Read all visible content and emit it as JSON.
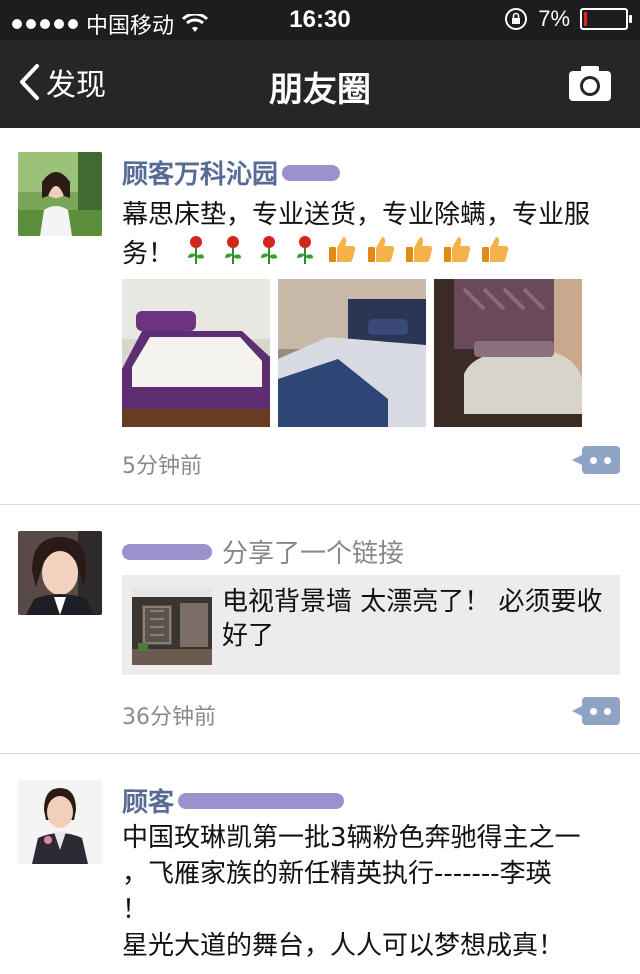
{
  "status_bar": {
    "carrier": "中国移动",
    "time": "16:30",
    "battery": "7%",
    "battery_level": 0.07,
    "colors": {
      "battery_low": "#e1251b"
    }
  },
  "nav": {
    "back_label": "发现",
    "title": "朋友圈"
  },
  "posts": [
    {
      "name": "顾客万科沁园",
      "text": "幕思床垫，专业送货，专业除螨，专业服务！",
      "emojis": [
        "rose",
        "rose",
        "rose",
        "rose",
        "thumbs-up",
        "thumbs-up",
        "thumbs-up",
        "thumbs-up",
        "thumbs-up"
      ],
      "time": "5分钟前"
    },
    {
      "name": "",
      "action": "分享了一个链接",
      "link_title": "电视背景墙  太漂亮了！ 必须要收好了",
      "time": "36分钟前"
    },
    {
      "name": "顾客",
      "lines": [
        "中国玫琳凯第一批3辆粉色奔驰得主之一",
        "，飞雁家族的新任精英执行-------李瑛",
        "！",
        "星光大道的舞台，人人可以梦想成真！"
      ]
    }
  ],
  "colors": {
    "name_link": "#576b95",
    "nav_bg": "#262629",
    "status_bg": "#1d1d1f",
    "comment_btn": "#8fa3c5"
  }
}
